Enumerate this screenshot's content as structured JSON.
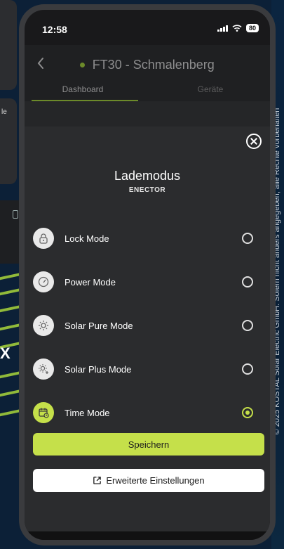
{
  "background": {
    "left_text": "le",
    "left_big_text": "X",
    "copyright": "© 2025 KOSTAL Solar Electric GmbH. Sofern nicht anders angegeben, alle Rechte vorbehalten"
  },
  "status_bar": {
    "time": "12:58",
    "battery": "80"
  },
  "nav": {
    "title": "FT30 - Schmalenberg"
  },
  "tabs": [
    {
      "label": "Dashboard",
      "active": true
    },
    {
      "label": "Geräte",
      "active": false
    }
  ],
  "sheet": {
    "title": "Lademodus",
    "subtitle": "ENECTOR",
    "modes": [
      {
        "label": "Lock Mode",
        "icon": "lock-icon",
        "selected": false
      },
      {
        "label": "Power Mode",
        "icon": "gauge-icon",
        "selected": false
      },
      {
        "label": "Solar Pure Mode",
        "icon": "sun-icon",
        "selected": false
      },
      {
        "label": "Solar Plus Mode",
        "icon": "sun-plus-icon",
        "selected": false
      },
      {
        "label": "Time Mode",
        "icon": "calendar-clock-icon",
        "selected": true
      }
    ],
    "save_label": "Speichern",
    "advanced_label": "Erweiterte Einstellungen"
  },
  "colors": {
    "accent": "#c5e04a",
    "sheet_bg": "#2b2c2e",
    "nav_bg": "#1f2022"
  }
}
